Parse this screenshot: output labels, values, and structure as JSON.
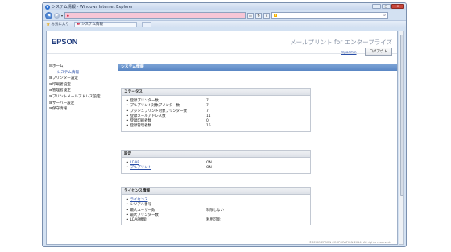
{
  "browser": {
    "window_title": "システム情報 - Windows Internet Explorer",
    "address_text": "",
    "search_text": "",
    "favorites_label": "お気に入り",
    "tab_title": "システム情報",
    "minimize": "–",
    "maximize": "□",
    "close": "✕"
  },
  "header": {
    "logo": "EPSON",
    "product_name": "メールプリント for エンタープライズ",
    "admin_link": "mpadmin",
    "logout_label": "ログアウト"
  },
  "sidebar": {
    "items": [
      {
        "label": "⊟ホーム"
      },
      {
        "label": "システム情報"
      },
      {
        "label": "⊞プリンター設定"
      },
      {
        "label": "⊞印刷者設定"
      },
      {
        "label": "⊞管理者設定"
      },
      {
        "label": "⊞プリントメールアドレス設定"
      },
      {
        "label": "⊞サーバー設定"
      },
      {
        "label": "⊞保守情報"
      }
    ]
  },
  "main": {
    "page_title": "システム情報",
    "status": {
      "title": "ステータス",
      "rows": [
        {
          "label": "登録プリンター数",
          "value": "7"
        },
        {
          "label": "プルプリント対象プリンター数",
          "value": "7"
        },
        {
          "label": "プッシュプリント対象プリンター数",
          "value": "7"
        },
        {
          "label": "登録メールアドレス数",
          "value": "11"
        },
        {
          "label": "登録印刷者数",
          "value": "0"
        },
        {
          "label": "登録管理者数",
          "value": "16"
        }
      ]
    },
    "settings": {
      "title": "設定",
      "rows": [
        {
          "label": "LDAP",
          "value": "ON"
        },
        {
          "label": "プルプリント",
          "value": "ON"
        }
      ]
    },
    "license": {
      "title": "ライセンス情報",
      "rows": [
        {
          "label": "ライセンス",
          "value": ""
        },
        {
          "label": "シリアル番号",
          "value": "-"
        },
        {
          "label": "最大ユーザー数",
          "value": "制限しない"
        },
        {
          "label": "最大プリンター数",
          "value": ""
        },
        {
          "label": "LDAP機能",
          "value": "利用可能"
        }
      ]
    }
  },
  "footer": "©SEIKO EPSON CORPORATION 2014. All rights reserved."
}
